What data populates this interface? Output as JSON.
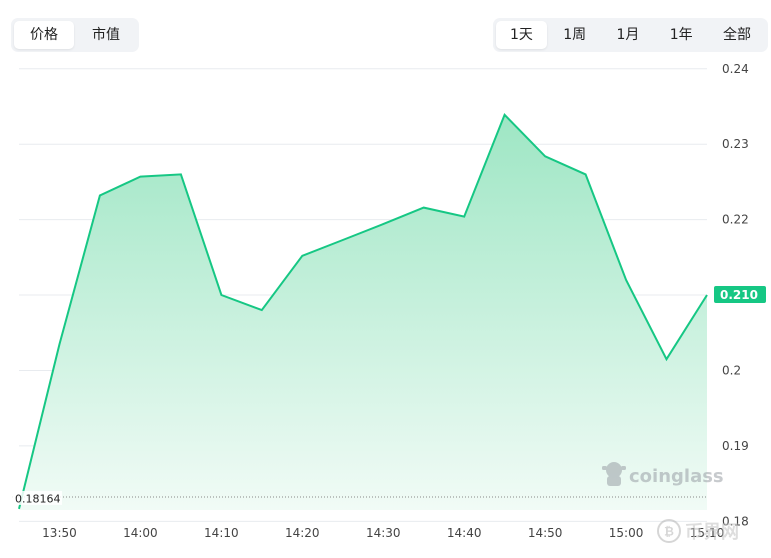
{
  "metric_tabs": [
    {
      "label": "价格",
      "active": true
    },
    {
      "label": "市值",
      "active": false
    }
  ],
  "range_tabs": [
    {
      "label": "1天",
      "active": true
    },
    {
      "label": "1周",
      "active": false
    },
    {
      "label": "1月",
      "active": false
    },
    {
      "label": "1年",
      "active": false
    },
    {
      "label": "全部",
      "active": false
    }
  ],
  "watermark": "coinglass",
  "corner_watermark": "币界网",
  "colors": {
    "line": "#16c784",
    "area_top": "#9ee6c4",
    "area_bottom": "#f1fbf6",
    "price_badge": "#16c784",
    "grid": "#e8ebef"
  },
  "chart_data": {
    "type": "area",
    "x": [
      "13:45",
      "13:50",
      "13:55",
      "14:00",
      "14:05",
      "14:10",
      "14:15",
      "14:20",
      "14:25",
      "14:30",
      "14:35",
      "14:40",
      "14:45",
      "14:50",
      "14:55",
      "15:00",
      "15:05",
      "15:10"
    ],
    "series": [
      {
        "values": [
          0.18164,
          0.2035,
          0.2232,
          0.2257,
          0.226,
          0.21,
          0.208,
          0.2152,
          0.2173,
          0.2194,
          0.2216,
          0.2204,
          0.2339,
          0.2284,
          0.226,
          0.212,
          0.2015,
          0.21
        ]
      }
    ],
    "x_tick_labels": [
      "13:50",
      "14:00",
      "14:10",
      "14:20",
      "14:30",
      "14:40",
      "14:50",
      "15:00",
      "15:10"
    ],
    "y_ticks": [
      0.18,
      0.19,
      0.2,
      0.21,
      0.22,
      0.23,
      0.24
    ],
    "y_tick_labels": [
      "0.18",
      "0.19",
      "0.2",
      "0.21",
      "0.22",
      "0.23",
      "0.24"
    ],
    "ylim": [
      0.1815,
      0.2405
    ],
    "current_value_label": "0.210",
    "min_value_label": "0.18164",
    "grid": true,
    "y_axis_position": "right"
  }
}
